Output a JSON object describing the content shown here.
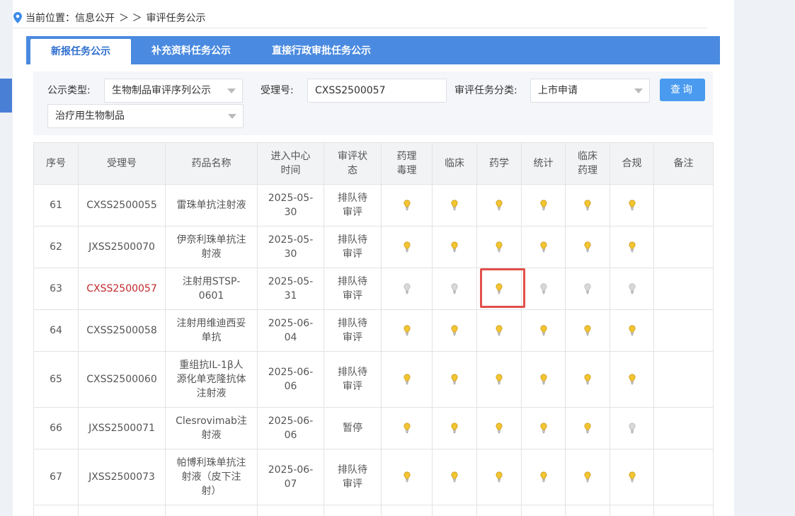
{
  "breadcrumb": {
    "prefix": "当前位置：",
    "path1": "信息公开",
    "sep": "＞ ＞",
    "path2": "审评任务公示"
  },
  "tabs": [
    {
      "label": "新报任务公示",
      "active": true
    },
    {
      "label": "补充资料任务公示",
      "active": false
    },
    {
      "label": "直接行政审批任务公示",
      "active": false
    }
  ],
  "filter": {
    "type_label": "公示类型:",
    "type_value": "生物制品审评序列公示",
    "accept_label": "受理号:",
    "accept_value": "CXSS2500057",
    "category_label": "审评任务分类:",
    "category_value": "上市申请",
    "sub_value": "治疗用生物制品",
    "query_button": "查询"
  },
  "table": {
    "headers": [
      "序号",
      "受理号",
      "药品名称",
      "进入中心\n时间",
      "审评状\n态",
      "药理\n毒理",
      "临床",
      "药学",
      "统计",
      "临床\n药理",
      "合规",
      "备注"
    ],
    "rows": [
      {
        "no": "61",
        "id": "CXSS2500055",
        "name": "雷珠单抗注射液",
        "date": "2025-05-\n30",
        "status": "排队待\n审评",
        "lights": [
          1,
          1,
          1,
          1,
          1,
          1
        ],
        "note": ""
      },
      {
        "no": "62",
        "id": "JXSS2500070",
        "name": "伊奈利珠单抗注\n射液",
        "date": "2025-05-\n30",
        "status": "排队待\n审评",
        "lights": [
          1,
          1,
          1,
          1,
          1,
          1
        ],
        "note": ""
      },
      {
        "no": "63",
        "id": "CXSS2500057",
        "name": "注射用STSP-\n0601",
        "date": "2025-05-\n31",
        "status": "排队待\n审评",
        "lights": [
          0,
          0,
          1,
          0,
          0,
          0
        ],
        "note": "",
        "highlight": true
      },
      {
        "no": "64",
        "id": "CXSS2500058",
        "name": "注射用维迪西妥\n单抗",
        "date": "2025-06-\n04",
        "status": "排队待\n审评",
        "lights": [
          1,
          1,
          1,
          1,
          1,
          1
        ],
        "note": ""
      },
      {
        "no": "65",
        "id": "CXSS2500060",
        "name": "重组抗IL-1β人\n源化单克隆抗体\n注射液",
        "date": "2025-06-\n06",
        "status": "排队待\n审评",
        "lights": [
          1,
          1,
          1,
          1,
          1,
          1
        ],
        "note": ""
      },
      {
        "no": "66",
        "id": "JXSS2500071",
        "name": "Clesrovimab注\n射液",
        "date": "2025-06-\n06",
        "status": "暂停",
        "lights": [
          1,
          1,
          1,
          1,
          1,
          0
        ],
        "note": ""
      },
      {
        "no": "67",
        "id": "JXSS2500073",
        "name": "帕博利珠单抗注\n射液（皮下注\n射）",
        "date": "2025-06-\n07",
        "status": "排队待\n审评",
        "lights": [
          1,
          1,
          1,
          1,
          1,
          1
        ],
        "note": ""
      }
    ]
  },
  "colors": {
    "tab_bar": "#4a8ae0",
    "bulb_on": "#f2c531",
    "bulb_off": "#d8d8d8",
    "highlight_id": "#c0282d",
    "highlight_box": "#e2504a"
  }
}
